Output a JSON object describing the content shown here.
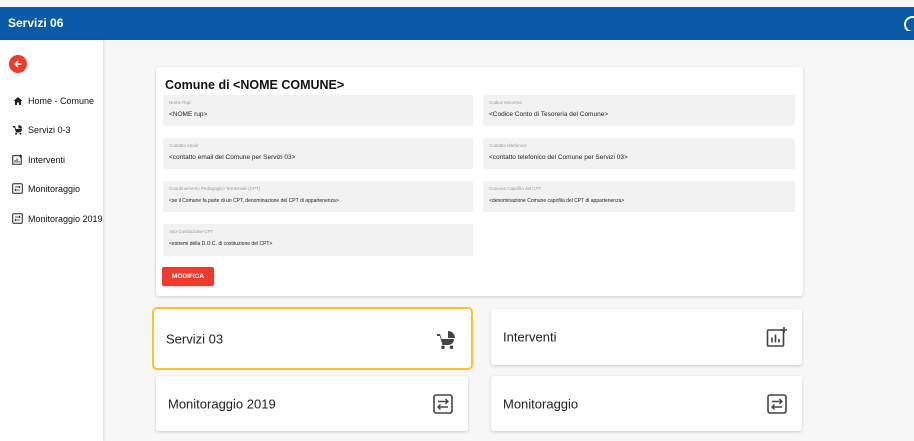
{
  "app": {
    "title": "Servizi 06"
  },
  "sidebar": {
    "items": [
      {
        "label": "Home - Comune",
        "icon": "home-icon"
      },
      {
        "label": "Servizi 0-3",
        "icon": "stroller-icon"
      },
      {
        "label": "Interventi",
        "icon": "chart-plus-icon"
      },
      {
        "label": "Monitoraggio",
        "icon": "monitor-icon"
      },
      {
        "label": "Monitoraggio 2019",
        "icon": "monitor-icon"
      }
    ]
  },
  "info": {
    "title": "Comune di  <NOME COMUNE>",
    "fields": [
      {
        "label": "Nome Rup",
        "value": "<NOME rup>"
      },
      {
        "label": "Codice tesoreria",
        "value": "<Codice Conto di Tesoreria del Comune>"
      },
      {
        "label": "Contatto email",
        "value": "<contatto email del Comune per Servizi 03>"
      },
      {
        "label": "Contatto telefonico",
        "value": "<contatto telefonico del Comune per Servizi 03>"
      },
      {
        "label": "Coordinamento Pedagogico Territoriale (CPT)",
        "value": "<se il Comune fa parte di un CPT, denominazione del CPT di appartenenza>"
      },
      {
        "label": "Comune Capofila del CPT",
        "value": "<denominazione Comune capofila del CPT di appartenenza>"
      },
      {
        "label": "Atto Costituzione CPT",
        "value": "<estremi della D.O.C. di costituzione del CPT>"
      }
    ],
    "edit_button": "MODIFICA"
  },
  "tiles": [
    {
      "label": "Servizi 03",
      "icon": "stroller-icon",
      "selected": true
    },
    {
      "label": "Interventi",
      "icon": "chart-plus-icon",
      "selected": false
    },
    {
      "label": "Monitoraggio 2019",
      "icon": "monitor-icon",
      "selected": false
    },
    {
      "label": "Monitoraggio",
      "icon": "monitor-icon",
      "selected": false
    }
  ],
  "colors": {
    "topbar": "#0b5aa8",
    "accent": "#ee3b2d",
    "selection": "#f7c62f"
  }
}
